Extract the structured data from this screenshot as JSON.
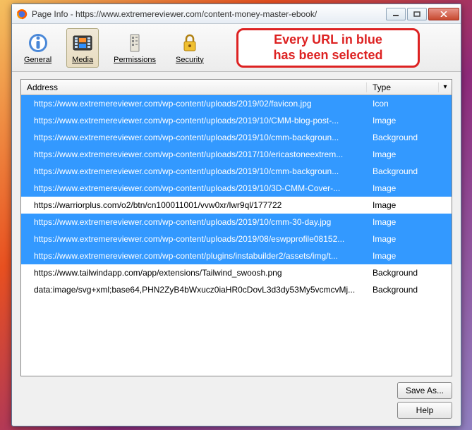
{
  "window": {
    "title": "Page Info - https://www.extremereviewer.com/content-money-master-ebook/"
  },
  "toolbar": {
    "general": "General",
    "media": "Media",
    "permissions": "Permissions",
    "security": "Security"
  },
  "callout": {
    "line1": "Every URL in blue",
    "line2": "has been selected"
  },
  "columns": {
    "address": "Address",
    "type": "Type"
  },
  "rows": [
    {
      "selected": true,
      "address": "https://www.extremereviewer.com/wp-content/uploads/2019/02/favicon.jpg",
      "type": "Icon"
    },
    {
      "selected": true,
      "address": "https://www.extremereviewer.com/wp-content/uploads/2019/10/CMM-blog-post-...",
      "type": "Image"
    },
    {
      "selected": true,
      "address": "https://www.extremereviewer.com/wp-content/uploads/2019/10/cmm-backgroun...",
      "type": "Background"
    },
    {
      "selected": true,
      "address": "https://www.extremereviewer.com/wp-content/uploads/2017/10/ericastoneextrem...",
      "type": "Image"
    },
    {
      "selected": true,
      "address": "https://www.extremereviewer.com/wp-content/uploads/2019/10/cmm-backgroun...",
      "type": "Background"
    },
    {
      "selected": true,
      "address": "https://www.extremereviewer.com/wp-content/uploads/2019/10/3D-CMM-Cover-...",
      "type": "Image"
    },
    {
      "selected": false,
      "address": "https://warriorplus.com/o2/btn/cn100011001/vvw0xr/lwr9ql/177722",
      "type": "Image"
    },
    {
      "selected": true,
      "address": "https://www.extremereviewer.com/wp-content/uploads/2019/10/cmm-30-day.jpg",
      "type": "Image"
    },
    {
      "selected": true,
      "address": "https://www.extremereviewer.com/wp-content/uploads/2019/08/eswpprofile08152...",
      "type": "Image"
    },
    {
      "selected": true,
      "address": "https://www.extremereviewer.com/wp-content/plugins/instabuilder2/assets/img/t...",
      "type": "Image"
    },
    {
      "selected": false,
      "address": "https://www.tailwindapp.com/app/extensions/Tailwind_swoosh.png",
      "type": "Background"
    },
    {
      "selected": false,
      "address": "data:image/svg+xml;base64,PHN2ZyB4bWxucz0iaHR0cDovL3d3dy53My5vcmcvMj...",
      "type": "Background"
    }
  ],
  "buttons": {
    "save": "Save As...",
    "help": "Help"
  }
}
